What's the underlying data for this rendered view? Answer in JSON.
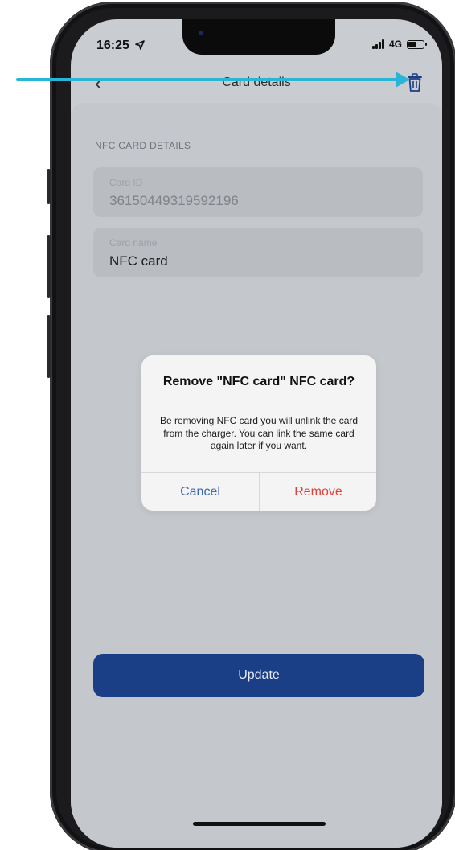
{
  "status_bar": {
    "time": "16:25",
    "network": "4G"
  },
  "navbar": {
    "title": "Card details",
    "back_icon": "chevron-left-icon",
    "delete_icon": "trash-icon"
  },
  "section": {
    "label": "NFC CARD DETAILS"
  },
  "fields": {
    "card_id": {
      "label": "Card ID",
      "value": "36150449319592196"
    },
    "card_name": {
      "label": "Card name",
      "value": "NFC card"
    }
  },
  "actions": {
    "update_label": "Update"
  },
  "dialog": {
    "title": "Remove \"NFC card\" NFC card?",
    "message": "Be removing NFC card you will unlink the card from the charger. You can link the same card again later if you want.",
    "cancel_label": "Cancel",
    "remove_label": "Remove"
  },
  "colors": {
    "accent_blue": "#1a3f86",
    "cancel_blue": "#3b68b5",
    "remove_red": "#e2413a",
    "annotation_arrow": "#29b6d6"
  }
}
